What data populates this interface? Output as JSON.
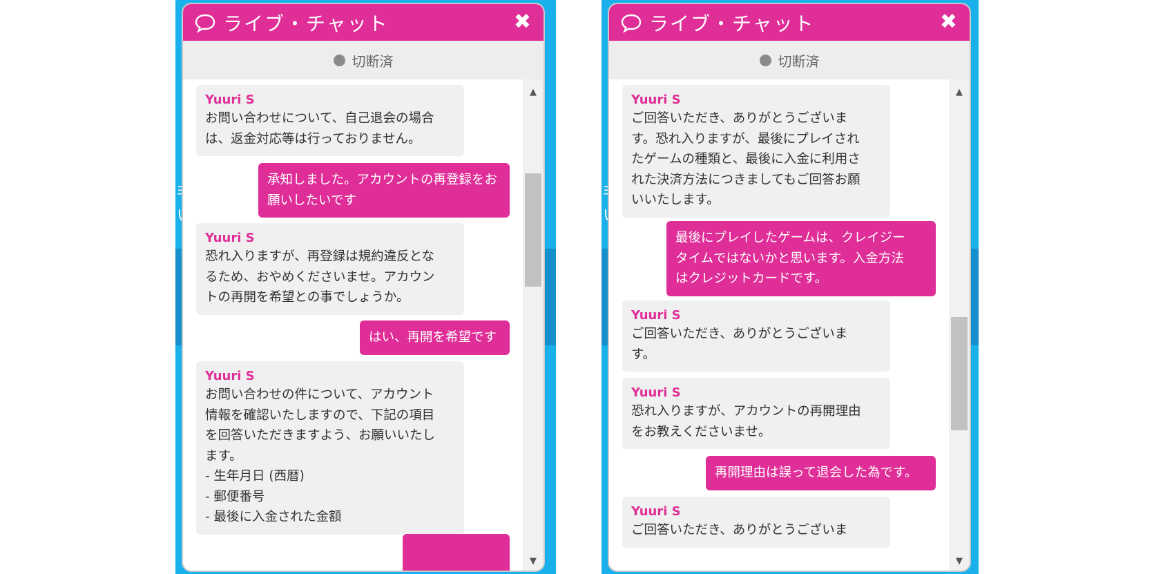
{
  "left_panel": {
    "header": {
      "title": "ライブ・チャット",
      "close_glyph": "✖"
    },
    "status": {
      "label": "切断済"
    },
    "scroll": {
      "up": "▲",
      "down": "▼"
    },
    "background_fragment": "非\nい",
    "messages": [
      {
        "type": "agent",
        "sender": "Yuuri S",
        "text": "お問い合わせについて、自己退会の場合\nは、返金対応等は行っておりません。"
      },
      {
        "type": "user",
        "text": "承知しました。アカウントの再登録をお\n願いしたいです"
      },
      {
        "type": "agent",
        "sender": "Yuuri S",
        "text": "恐れ入りますが、再登録は規約違反とな\nるため、おやめくださいませ。アカウン\nトの再開を希望との事でしょうか。"
      },
      {
        "type": "user",
        "text": "はい、再開を希望です"
      },
      {
        "type": "agent",
        "sender": "Yuuri S",
        "text": "お問い合わせの件について、アカウント\n情報を確認いたしますので、下記の項目\nを回答いただきますよう、お願いいたし\nます。\n- 生年月日 (西暦)\n- 郵便番号\n- 最後に入金された金額"
      },
      {
        "type": "user",
        "text": ""
      }
    ]
  },
  "right_panel": {
    "header": {
      "title": "ライブ・チャット",
      "close_glyph": "✖"
    },
    "status": {
      "label": "切断済"
    },
    "scroll": {
      "up": "▲",
      "down": "▼"
    },
    "background_fragment": "非\nい",
    "messages": [
      {
        "type": "agent",
        "sender": "Yuuri S",
        "text": "ご回答いただき、ありがとうございま\nす。恐れ入りますが、最後にプレイされ\nたゲームの種類と、最後に入金に利用さ\nれた決済方法につきましてもご回答お願\nいいたします。"
      },
      {
        "type": "user",
        "text": "最後にプレイしたゲームは、クレイジー\nタイムではないかと思います。入金方法\nはクレジットカードです。"
      },
      {
        "type": "agent",
        "sender": "Yuuri S",
        "text": "ご回答いただき、ありがとうございま\nす。"
      },
      {
        "type": "agent",
        "sender": "Yuuri S",
        "text": "恐れ入りますが、アカウントの再開理由\nをお教えくださいませ。"
      },
      {
        "type": "user",
        "text": "再開理由は誤って退会した為です。"
      },
      {
        "type": "agent",
        "sender": "Yuuri S",
        "text": "ご回答いただき、ありがとうございま"
      }
    ]
  },
  "colors": {
    "brand": "#df2e97",
    "page_background": "#1ab0ec",
    "status_dot": "#8a8a8a",
    "agent_bubble": "#f0f0f0"
  }
}
